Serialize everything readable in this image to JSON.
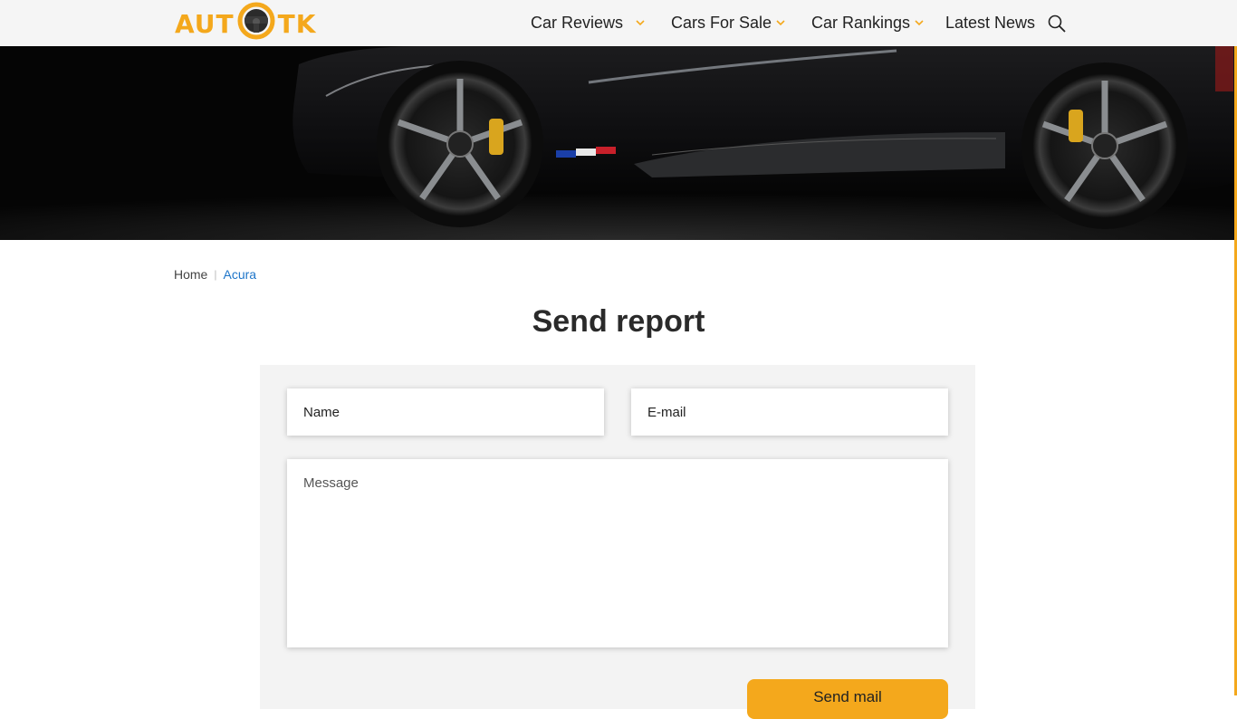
{
  "brand": {
    "logo_left": "AUT",
    "logo_right": "TK",
    "accent_color": "#f4a81c",
    "logo_icon": "steering-wheel-icon"
  },
  "nav": {
    "items": [
      {
        "label": "Car Reviews",
        "has_dropdown": true
      },
      {
        "label": "Cars For Sale",
        "has_dropdown": true
      },
      {
        "label": "Car Rankings",
        "has_dropdown": true
      },
      {
        "label": "Latest News",
        "has_dropdown": false
      }
    ],
    "search_icon": "search-icon"
  },
  "hero": {
    "image": "black-sports-car-side-view"
  },
  "breadcrumb": {
    "home": "Home",
    "current": "Acura"
  },
  "page": {
    "title": "Send report"
  },
  "form": {
    "name_placeholder": "Name",
    "email_placeholder": "E-mail",
    "message_placeholder": "Message",
    "submit_label": "Send mail"
  }
}
